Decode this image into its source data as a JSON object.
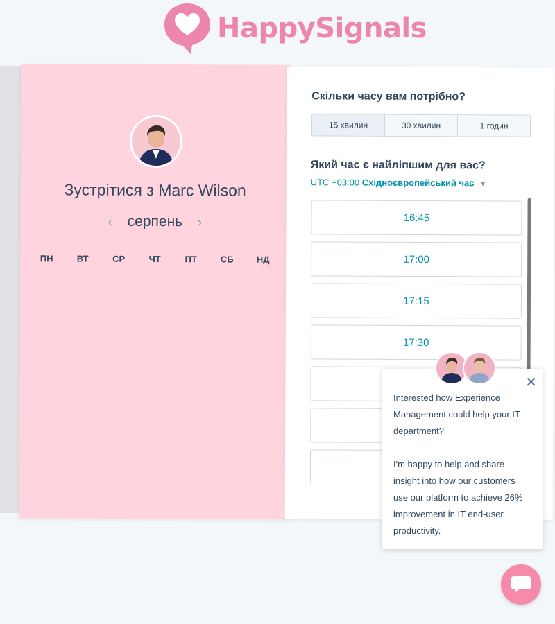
{
  "brand": {
    "name": "HappySignals",
    "color": "#ec86ad"
  },
  "meeting": {
    "title": "Зустрітися з Marc Wilson",
    "month": "серпень",
    "weekdays": [
      "ПН",
      "ВТ",
      "СР",
      "ЧТ",
      "ПТ",
      "СБ",
      "НД"
    ]
  },
  "duration": {
    "question": "Скільки часу вам потрібно?",
    "options": [
      "15 хвилин",
      "30 хвилин",
      "1 годин"
    ],
    "selected": "15 хвилин"
  },
  "time": {
    "question": "Який час є найліпшим для вас?",
    "timezone_offset": "UTC +03:00",
    "timezone_name": "Східноєвропейський час",
    "slots": [
      "16:45",
      "17:00",
      "17:15",
      "17:30",
      "",
      "",
      "",
      ""
    ]
  },
  "chat": {
    "message_1": "Interested how Experience Management could help your IT department?",
    "message_2": "I'm happy to help and share insight into how our customers use our platform to achieve 26% improvement in IT end-user productivity."
  },
  "colors": {
    "accent": "#0091ae",
    "pink_panel": "#ffd4de",
    "launcher": "#f58aaa"
  }
}
